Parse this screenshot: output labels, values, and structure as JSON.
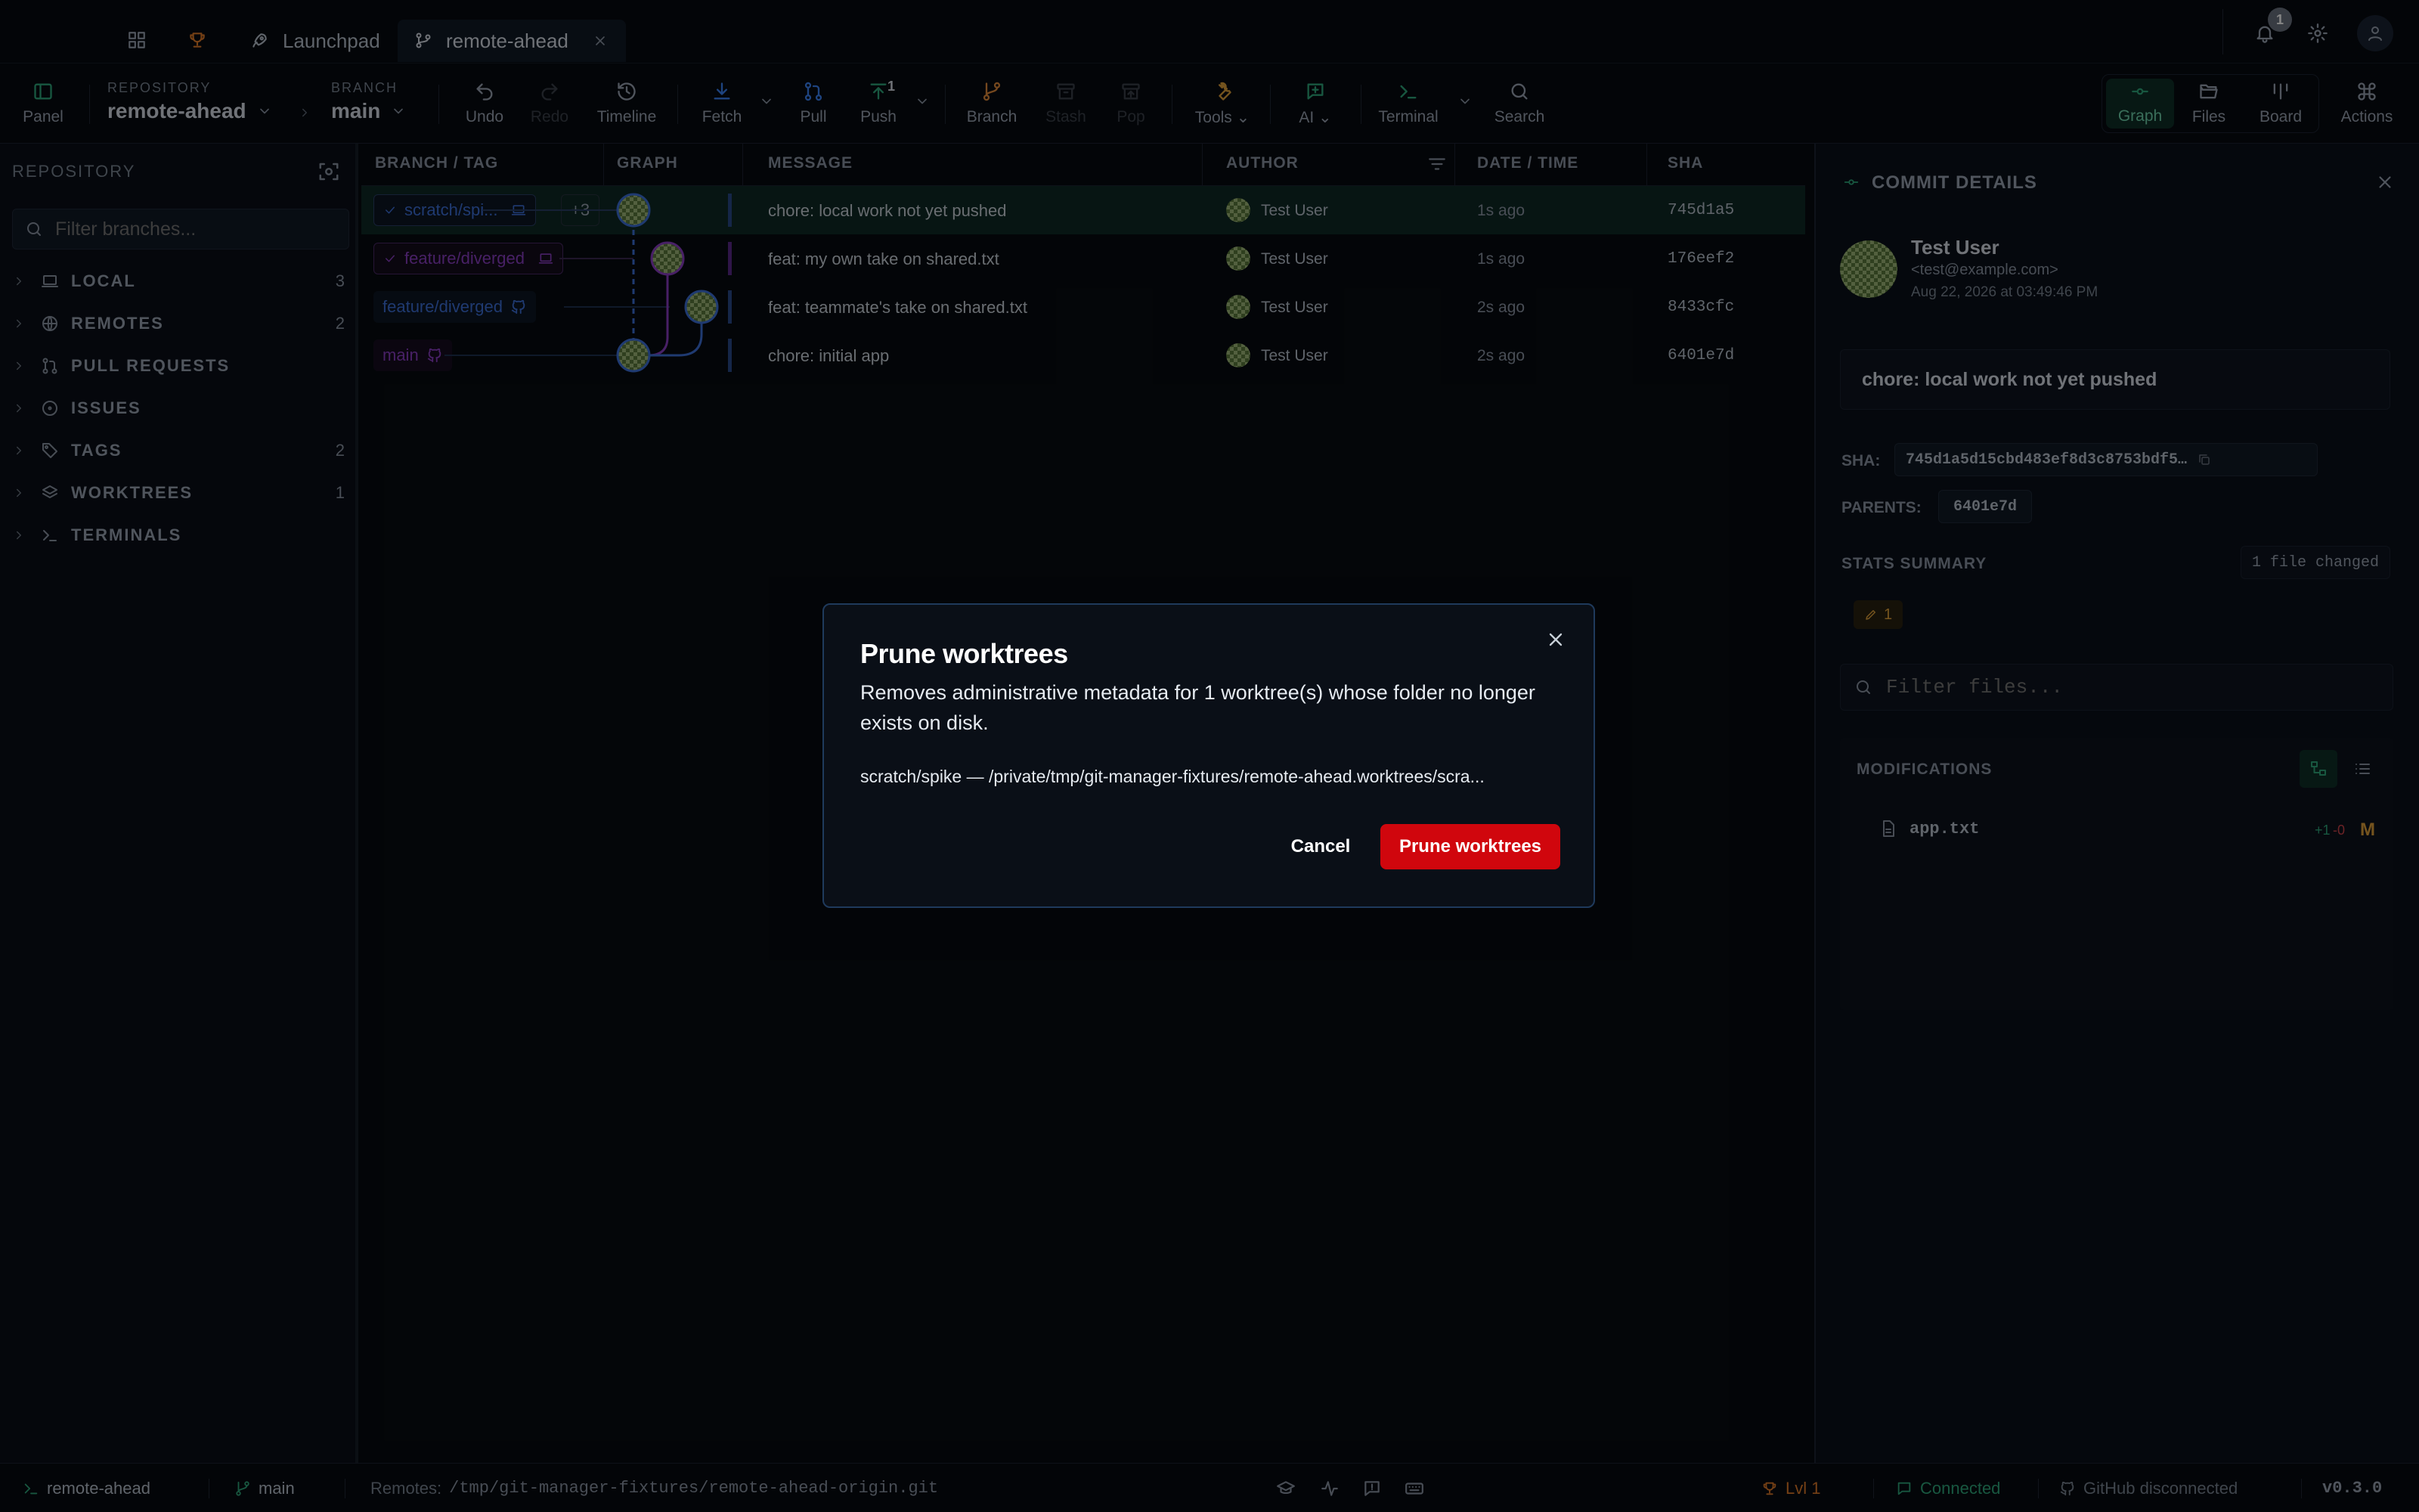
{
  "topbar": {
    "tabs": [
      {
        "label": "Launchpad"
      },
      {
        "label": "remote-ahead"
      }
    ],
    "notification_count": "1"
  },
  "toolbar": {
    "panel": "Panel",
    "repo_caption": "REPOSITORY",
    "repo_name": "remote-ahead",
    "branch_caption": "BRANCH",
    "branch_name": "main",
    "undo": "Undo",
    "redo": "Redo",
    "timeline": "Timeline",
    "fetch": "Fetch",
    "pull": "Pull",
    "push": "Push",
    "push_count": "1",
    "branch": "Branch",
    "stash": "Stash",
    "pop": "Pop",
    "tools": "Tools",
    "ai": "AI",
    "terminal": "Terminal",
    "search": "Search",
    "graph": "Graph",
    "files": "Files",
    "board": "Board",
    "actions": "Actions"
  },
  "sidebar": {
    "title": "REPOSITORY",
    "filter_placeholder": "Filter branches...",
    "sections": [
      {
        "label": "LOCAL",
        "count": "3"
      },
      {
        "label": "REMOTES",
        "count": "2"
      },
      {
        "label": "PULL REQUESTS",
        "count": ""
      },
      {
        "label": "ISSUES",
        "count": ""
      },
      {
        "label": "TAGS",
        "count": "2"
      },
      {
        "label": "WORKTREES",
        "count": "1"
      },
      {
        "label": "TERMINALS",
        "count": ""
      }
    ]
  },
  "graph": {
    "columns": [
      "BRANCH / TAG",
      "GRAPH",
      "MESSAGE",
      "AUTHOR",
      "DATE / TIME",
      "SHA"
    ],
    "more_refs": "+3",
    "rows": [
      {
        "ref": "scratch/spi...",
        "message": "chore: local work not yet pushed",
        "author": "Test User",
        "date": "1s ago",
        "sha": "745d1a5"
      },
      {
        "ref": "feature/diverged",
        "message": "feat: my own take on shared.txt",
        "author": "Test User",
        "date": "1s ago",
        "sha": "176eef2"
      },
      {
        "ref": "feature/diverged",
        "message": "feat: teammate's take on shared.txt",
        "author": "Test User",
        "date": "2s ago",
        "sha": "8433cfc"
      },
      {
        "ref": "main",
        "message": "chore: initial app",
        "author": "Test User",
        "date": "2s ago",
        "sha": "6401e7d"
      }
    ]
  },
  "details": {
    "title": "COMMIT DETAILS",
    "author_name": "Test User",
    "author_email": "<test@example.com>",
    "date": "Aug 22, 2026 at 03:49:46 PM",
    "message": "chore: local work not yet pushed",
    "sha_label": "SHA:",
    "sha": "745d1a5d15cbd483ef8d3c8753bdf5…",
    "parents_label": "PARENTS:",
    "parent": "6401e7d",
    "stats_label": "STATS SUMMARY",
    "files_changed": "1 file changed",
    "modified_count": "1",
    "filter_placeholder": "Filter files...",
    "modifications_label": "MODIFICATIONS",
    "file": {
      "name": "app.txt",
      "added": "+1",
      "removed": "-0",
      "status": "M"
    }
  },
  "modal": {
    "title": "Prune worktrees",
    "description": "Removes administrative metadata for 1 worktree(s) whose folder no longer exists on disk.",
    "entry": "scratch/spike — /private/tmp/git-manager-fixtures/remote-ahead.worktrees/scra...",
    "cancel": "Cancel",
    "confirm": "Prune worktrees"
  },
  "status": {
    "repo": "remote-ahead",
    "branch": "main",
    "remotes_label": "Remotes:",
    "remotes": "/tmp/git-manager-fixtures/remote-ahead-origin.git",
    "level": "Lvl 1",
    "connected": "Connected",
    "github": "GitHub disconnected",
    "version": "v0.3.0"
  },
  "colors": {
    "accent": "#2ea87c",
    "danger": "#d0060d",
    "branch_blue": "#3d6fd8",
    "branch_purple": "#8a3fc4"
  }
}
